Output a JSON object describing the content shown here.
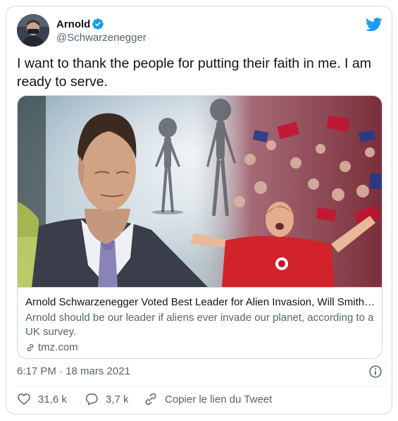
{
  "author": {
    "name": "Arnold",
    "handle": "@Schwarzenegger",
    "verified": true
  },
  "tweet": {
    "text": "I want to thank the people for putting their faith in me. I am ready to serve."
  },
  "card": {
    "title": "Arnold Schwarzenegger Voted Best Leader for Alien Invasion, Will Smith Second",
    "description": "Arnold should be our leader if aliens ever invade our planet, according to a UK survey.",
    "domain": "tmz.com"
  },
  "meta": {
    "timestamp": "6:17 PM · 18 mars 2021"
  },
  "actions": {
    "likes": "31,6 k",
    "replies": "3,7 k",
    "copy_link": "Copier le lien du Tweet"
  },
  "icons": {
    "verified": "verified-badge-icon",
    "brand": "twitter-bird-icon",
    "info": "info-icon",
    "like": "heart-icon",
    "reply": "speech-bubble-icon",
    "link": "link-icon"
  },
  "colors": {
    "accent": "#1d9bf0",
    "text": "#0f1419",
    "secondary": "#536471",
    "border": "#cfd9de"
  }
}
